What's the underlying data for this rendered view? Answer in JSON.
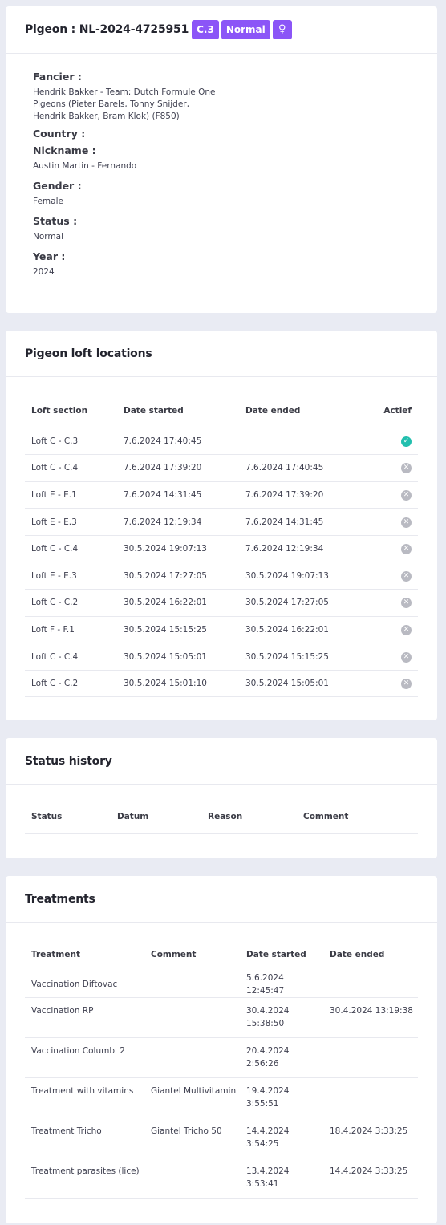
{
  "pigeon": {
    "title": "Pigeon : NL-2024-4725951",
    "badges": {
      "section": "C.3",
      "status": "Normal",
      "gender_icon": "♀"
    },
    "fields": [
      {
        "label": "Fancier :",
        "value": "Hendrik Bakker - Team: Dutch Formule One Pigeons (Pieter Barels, Tonny Snijder, Hendrik Bakker, Bram Klok) (F850)"
      },
      {
        "label": "Country :",
        "value": ""
      },
      {
        "label": "Nickname :",
        "value": "Austin Martin - Fernando"
      },
      {
        "label": "Gender :",
        "value": "Female"
      },
      {
        "label": "Status :",
        "value": "Normal"
      },
      {
        "label": "Year :",
        "value": "2024"
      }
    ]
  },
  "loft": {
    "title": "Pigeon loft locations",
    "headers": [
      "Loft section",
      "Date started",
      "Date ended",
      "Actief"
    ],
    "rows": [
      {
        "section": "Loft C - C.3",
        "started": "7.6.2024 17:40:45",
        "ended": "",
        "active": true
      },
      {
        "section": "Loft C - C.4",
        "started": "7.6.2024 17:39:20",
        "ended": "7.6.2024 17:40:45",
        "active": false
      },
      {
        "section": "Loft E - E.1",
        "started": "7.6.2024 14:31:45",
        "ended": "7.6.2024 17:39:20",
        "active": false
      },
      {
        "section": "Loft E - E.3",
        "started": "7.6.2024 12:19:34",
        "ended": "7.6.2024 14:31:45",
        "active": false
      },
      {
        "section": "Loft C - C.4",
        "started": "30.5.2024 19:07:13",
        "ended": "7.6.2024 12:19:34",
        "active": false
      },
      {
        "section": "Loft E - E.3",
        "started": "30.5.2024 17:27:05",
        "ended": "30.5.2024 19:07:13",
        "active": false
      },
      {
        "section": "Loft C - C.2",
        "started": "30.5.2024 16:22:01",
        "ended": "30.5.2024 17:27:05",
        "active": false
      },
      {
        "section": "Loft F - F.1",
        "started": "30.5.2024 15:15:25",
        "ended": "30.5.2024 16:22:01",
        "active": false
      },
      {
        "section": "Loft C - C.4",
        "started": "30.5.2024 15:05:01",
        "ended": "30.5.2024 15:15:25",
        "active": false
      },
      {
        "section": "Loft C - C.2",
        "started": "30.5.2024 15:01:10",
        "ended": "30.5.2024 15:05:01",
        "active": false
      }
    ]
  },
  "status_history": {
    "title": "Status history",
    "headers": [
      "Status",
      "Datum",
      "Reason",
      "Comment"
    ]
  },
  "treatments": {
    "title": "Treatments",
    "headers": [
      "Treatment",
      "Comment",
      "Date started",
      "Date ended"
    ],
    "rows": [
      {
        "treatment": "Vaccination Diftovac",
        "comment": "",
        "started": "5.6.2024 12:45:47",
        "ended": ""
      },
      {
        "treatment": "Vaccination RP",
        "comment": "",
        "started": "30.4.2024 15:38:50",
        "ended": "30.4.2024 13:19:38"
      },
      {
        "treatment": "Vaccination Columbi 2",
        "comment": "",
        "started": "20.4.2024 2:56:26",
        "ended": ""
      },
      {
        "treatment": "Treatment with vitamins",
        "comment": "Giantel Multivitamin",
        "started": "19.4.2024 3:55:51",
        "ended": ""
      },
      {
        "treatment": "Treatment Tricho",
        "comment": "Giantel Tricho 50",
        "started": "14.4.2024 3:54:25",
        "ended": "18.4.2024 3:33:25"
      },
      {
        "treatment": "Treatment parasites (lice)",
        "comment": "",
        "started": "13.4.2024 3:53:41",
        "ended": "14.4.2024 3:33:25"
      }
    ]
  },
  "colors": {
    "accent": "#8b55f7",
    "active": "#22bfae",
    "inactive": "#b9bac2",
    "background": "#e9ebf3"
  }
}
